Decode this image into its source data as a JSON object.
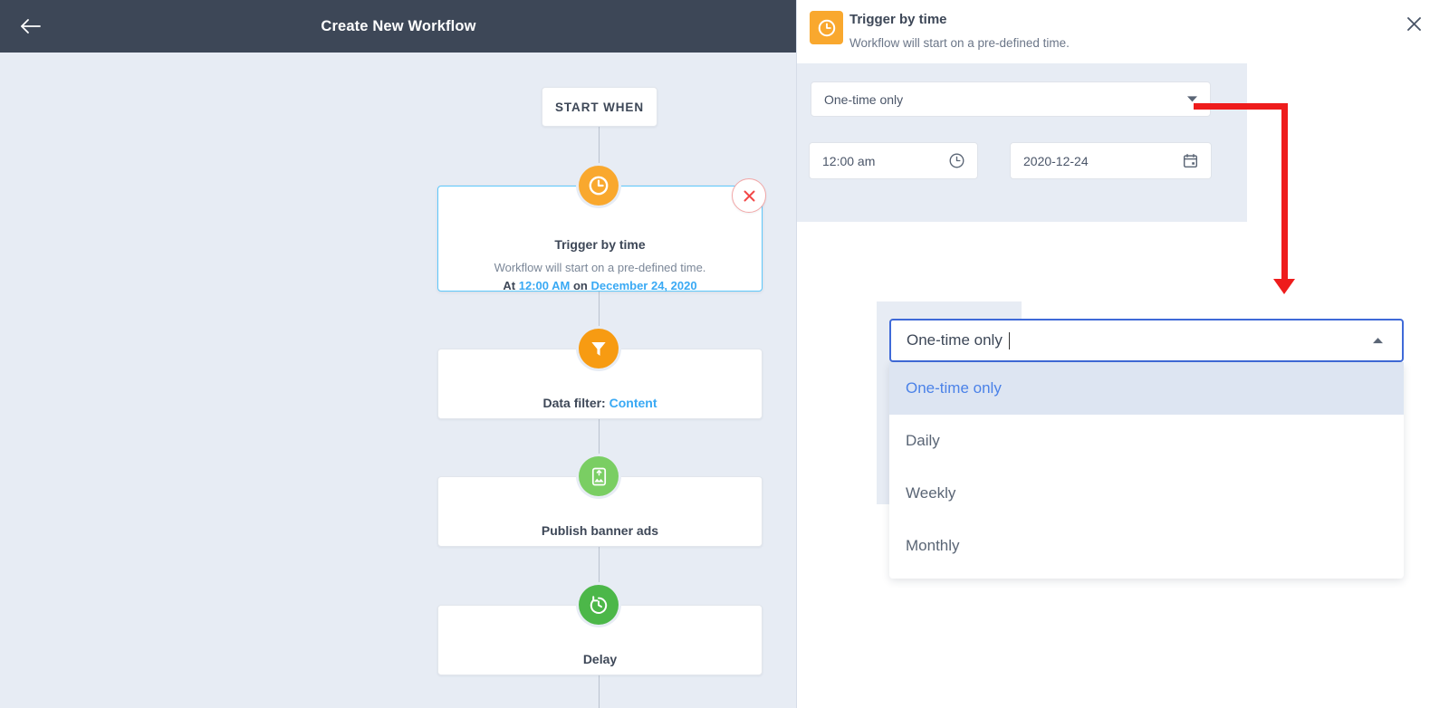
{
  "topbar": {
    "title": "Create New Workflow",
    "back_icon": "arrow-left-icon"
  },
  "canvas": {
    "start_label": "START WHEN",
    "nodes": [
      {
        "id": "trigger-by-time",
        "icon": "clock-icon",
        "title": "Trigger by time",
        "desc_line1": "Workflow will start on a pre-defined time.",
        "desc_prefix": "At ",
        "desc_time": "12:00 AM",
        "desc_mid": " on ",
        "desc_date": "December 24, 2020",
        "remove_icon": "close-icon",
        "selected": true
      },
      {
        "id": "data-filter",
        "icon": "funnel-icon",
        "title_prefix": "Data filter: ",
        "title_value": "Content"
      },
      {
        "id": "publish-banner-ads",
        "icon": "image-upload-icon",
        "title": "Publish banner ads"
      },
      {
        "id": "delay",
        "icon": "stopwatch-icon",
        "title": "Delay"
      }
    ]
  },
  "panel": {
    "icon": "clock-icon",
    "title": "Trigger by time",
    "subtitle": "Workflow will start on a pre-defined time.",
    "close_icon": "close-icon",
    "form": {
      "frequency": {
        "value": "One-time only",
        "icon": "chevron-down-icon"
      },
      "time": {
        "value": "12:00 am",
        "icon": "clock-icon"
      },
      "date": {
        "value": "2020-12-24",
        "icon": "calendar-icon"
      }
    }
  },
  "dropdown": {
    "input_value": "One-time only",
    "toggle_icon": "chevron-up-icon",
    "options": [
      {
        "label": "One-time only",
        "selected": true
      },
      {
        "label": "Daily",
        "selected": false
      },
      {
        "label": "Weekly",
        "selected": false
      },
      {
        "label": "Monthly",
        "selected": false
      }
    ]
  },
  "annotation": {
    "arrow_color": "#ee1c1c",
    "shape": "elbow-arrow-down"
  },
  "colors": {
    "header_bg": "#3d4757",
    "canvas_bg": "#e7ecf4",
    "accent_blue": "#39a9f4",
    "selected_border": "#5ec8fb",
    "orange": "#f9a82e",
    "green_light": "#7ace63",
    "green_dark": "#4cb749",
    "dropdown_focus": "#3f6ad8",
    "option_active_bg": "#dde5f2",
    "option_active_text": "#4b82e8"
  }
}
